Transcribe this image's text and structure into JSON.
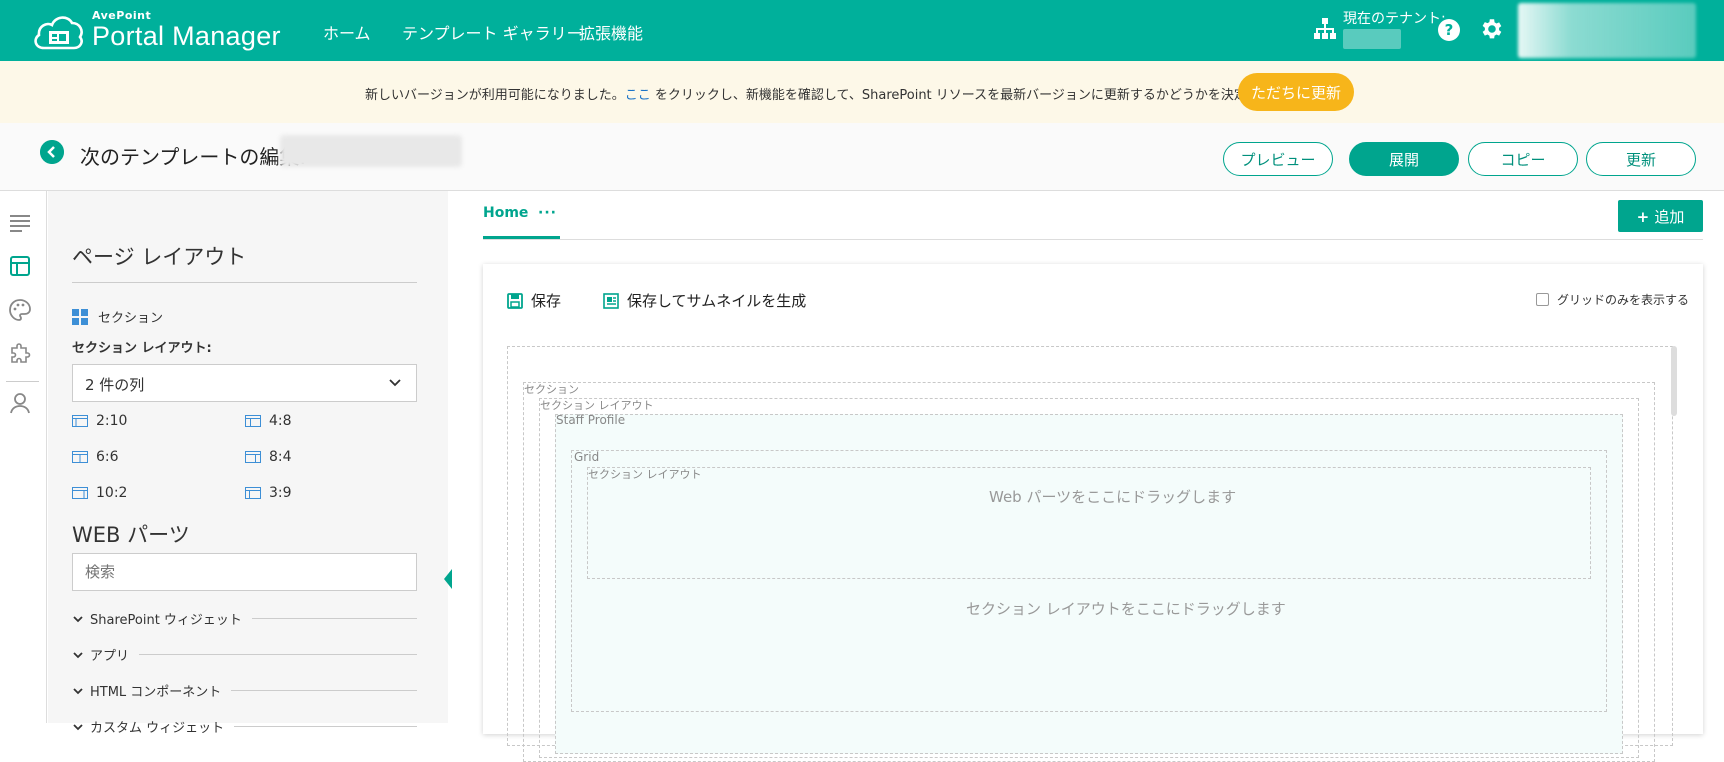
{
  "topbar": {
    "brand_small": "AvePoint",
    "brand_name": "Portal Manager",
    "nav": [
      "ホーム",
      "テンプレート ギャラリー",
      "拡張機能"
    ],
    "tenant_label": "現在のテナント:"
  },
  "banner": {
    "text_before": "新しいバージョンが利用可能になりました。",
    "link": "ここ",
    "text_after": " をクリックし、新機能を確認して、SharePoint リソースを最新バージョンに更新するかどうかを決定してください。",
    "update_button": "ただちに更新"
  },
  "edit_header": {
    "title": "次のテンプレートの編集:",
    "buttons": {
      "preview": "プレビュー",
      "deploy": "展開",
      "copy": "コピー",
      "refresh": "更新"
    }
  },
  "panel": {
    "title": "ページ レイアウト",
    "section_label": "セクション",
    "section_layout_label": "セクション レイアウト:",
    "select_value": "2 件の列",
    "layout_options": [
      "2:10",
      "4:8",
      "6:6",
      "8:4",
      "10:2",
      "3:9"
    ],
    "webparts_title": "WEB パーツ",
    "search_placeholder": "検索",
    "groups": [
      "SharePoint ウィジェット",
      "アプリ",
      "HTML コンポーネント",
      "カスタム ウィジェット"
    ]
  },
  "main": {
    "page_tab": "Home",
    "page_tab_more": "···",
    "add_button": "追加",
    "toolbar": {
      "save": "保存",
      "save_thumbnail": "保存してサムネイルを生成",
      "grid_only": "グリッドのみを表示する"
    },
    "canvas": {
      "section": "セクション",
      "section_layout": "セクション レイアウト",
      "staff_profile": "Staff Profile",
      "grid": "Grid",
      "inner_section_layout": "セクション レイアウト",
      "drop_webparts": "Web パーツをここにドラッグします",
      "drop_section_layout": "セクション レイアウトをここにドラッグします"
    }
  }
}
